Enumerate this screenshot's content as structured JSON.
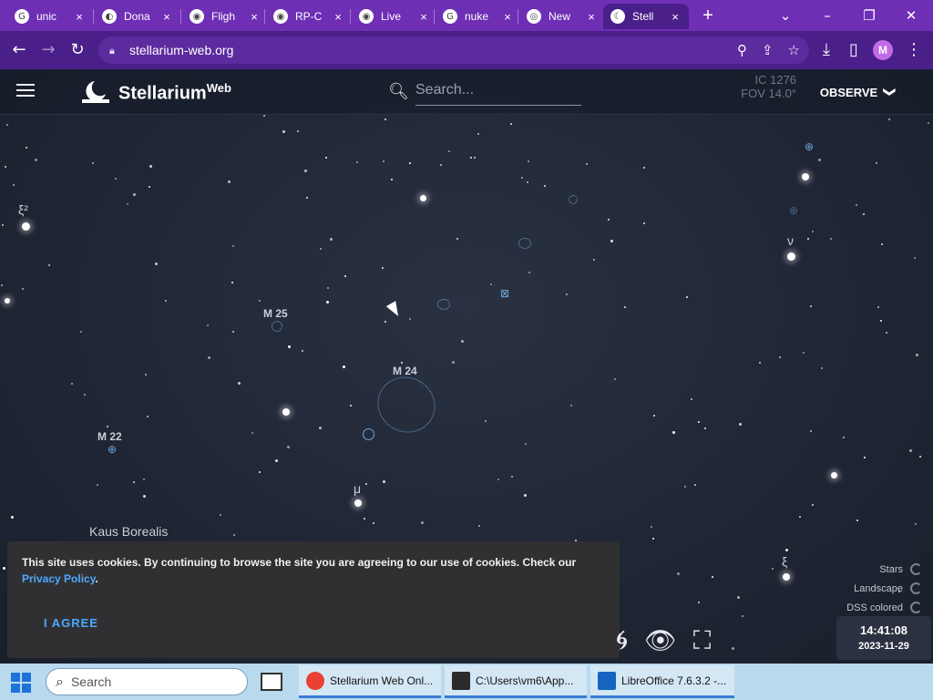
{
  "browser": {
    "tabs": [
      {
        "label": "unic",
        "icon": "G"
      },
      {
        "label": "Dona",
        "icon": "◐"
      },
      {
        "label": "Fligh",
        "icon": "◉"
      },
      {
        "label": "RP-C",
        "icon": "◉"
      },
      {
        "label": "Live",
        "icon": "◉"
      },
      {
        "label": "nuke",
        "icon": "G"
      },
      {
        "label": "New",
        "icon": "◎"
      },
      {
        "label": "Stell",
        "icon": "☾"
      }
    ],
    "tab_close": "×",
    "new_tab": "+",
    "url": "stellarium-web.org",
    "profile_initial": "M"
  },
  "app": {
    "brand": "Stellarium",
    "brand_sup": "Web",
    "search_placeholder": "Search...",
    "fov_line1": "IC 1276",
    "fov_line2": "FOV 14.0°",
    "observe_label": "OBSERVE",
    "observe_chevron": "❯"
  },
  "sky_labels": {
    "xi2": "ξ²",
    "nu": "ν",
    "m25": "M 25",
    "m24": "M 24",
    "m22": "M 22",
    "mu": "μ",
    "kaus": "Kaus Borealis",
    "xi": "ξ"
  },
  "cookie": {
    "text": "This site uses cookies. By continuing to browse the site you are agreeing to our use of cookies. Check our",
    "link": "Privacy Policy",
    "after": ".",
    "agree": "I AGREE"
  },
  "toggles": [
    "Stars",
    "Landscape",
    "DSS colored"
  ],
  "clock": {
    "time": "14:41:08",
    "date": "2023-11-29"
  },
  "taskbar": {
    "search_placeholder": "Search",
    "apps": [
      {
        "label": "Stellarium Web Onl...",
        "color": "#e94235"
      },
      {
        "label": "C:\\Users\\vm6\\App...",
        "color": "#2b2b2b"
      },
      {
        "label": "LibreOffice 7.6.3.2 -...",
        "color": "#1565c0"
      }
    ]
  }
}
